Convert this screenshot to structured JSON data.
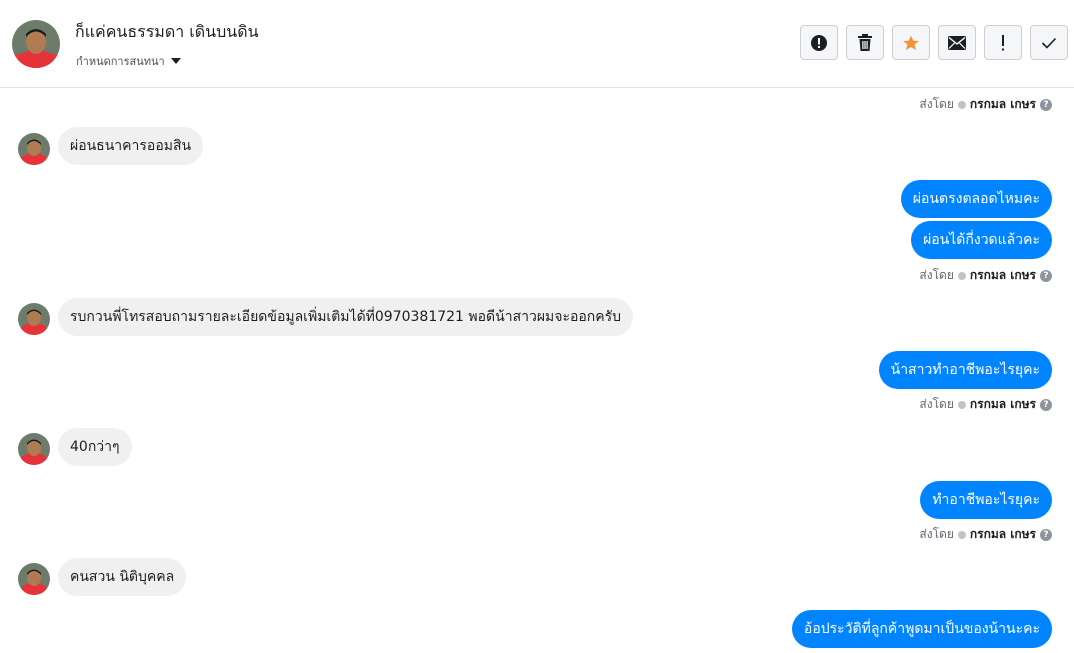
{
  "header": {
    "contact_name": "ก็แค่คนธรรมดา เดินบนดิน",
    "assign_label": "กำหนดการสนทนา"
  },
  "toolbar": {
    "buttons": [
      {
        "icon": "alert-circle-icon"
      },
      {
        "icon": "trash-icon"
      },
      {
        "icon": "star-icon",
        "color": "#f7923b"
      },
      {
        "icon": "envelope-icon"
      },
      {
        "icon": "exclamation-icon"
      },
      {
        "icon": "check-icon"
      }
    ]
  },
  "sent_by": {
    "prefix": "ส่งโดย",
    "name": "กรกมล เกษร",
    "help": "?"
  },
  "messages": [
    {
      "from": "customer",
      "text": "ผ่อนธนาคารออมสิน"
    },
    {
      "from": "page",
      "text": "ผ่อนตรงตลอดไหมคะ"
    },
    {
      "from": "page",
      "text": "ผ่อนได้กี่งวดแล้วคะ"
    },
    {
      "from": "customer",
      "text": "รบกวนพี่โทรสอบถามรายละเอียดข้อมูลเพิ่มเติมได้ที่0970381721  พอดีน้าสาวผมจะออกครับ"
    },
    {
      "from": "page",
      "text": "น้าสาวทำอาชีพอะไรยุคะ"
    },
    {
      "from": "customer",
      "text": "40กว่าๆ"
    },
    {
      "from": "page",
      "text": "ทำอาชีพอะไรยุคะ"
    },
    {
      "from": "customer",
      "text": "คนสวน นิติบุคคล"
    },
    {
      "from": "page",
      "text": "อ้อประวัติที่ลูกค้าพูดมาเป็นของน้านะคะ"
    }
  ],
  "colors": {
    "outgoing_bubble": "#0084ff",
    "incoming_bubble": "#f1f0f0"
  }
}
